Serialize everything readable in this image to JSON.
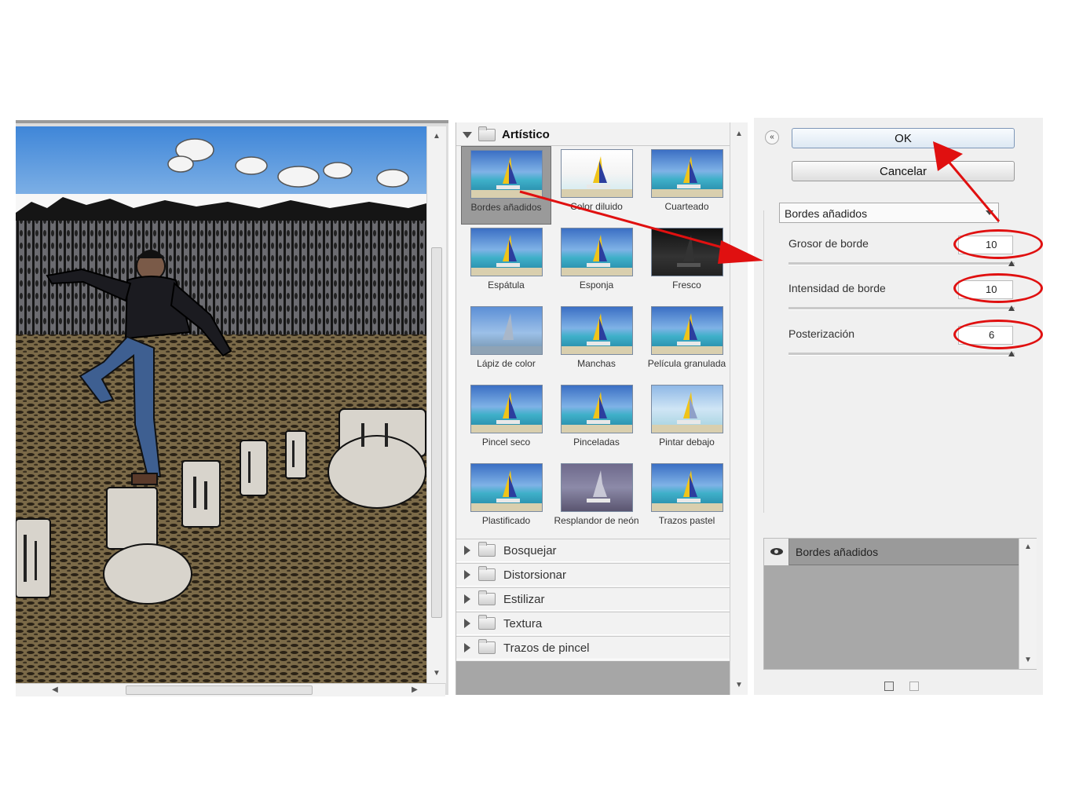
{
  "gallery": {
    "open_category": "Artístico",
    "thumbnails": [
      {
        "label": "Bordes añadidos",
        "selected": true
      },
      {
        "label": "Color diluido"
      },
      {
        "label": "Cuarteado"
      },
      {
        "label": "Espátula"
      },
      {
        "label": "Esponja"
      },
      {
        "label": "Fresco"
      },
      {
        "label": "Lápiz de color"
      },
      {
        "label": "Manchas"
      },
      {
        "label": "Película granulada"
      },
      {
        "label": "Pincel seco"
      },
      {
        "label": "Pinceladas"
      },
      {
        "label": "Pintar debajo"
      },
      {
        "label": "Plastificado"
      },
      {
        "label": "Resplandor de neón"
      },
      {
        "label": "Trazos pastel"
      }
    ],
    "collapsed_categories": [
      "Bosquejar",
      "Distorsionar",
      "Estilizar",
      "Textura",
      "Trazos de pincel"
    ]
  },
  "settings": {
    "ok_label": "OK",
    "cancel_label": "Cancelar",
    "filter_select": "Bordes añadidos",
    "params": [
      {
        "label": "Grosor de borde",
        "value": "10"
      },
      {
        "label": "Intensidad de borde",
        "value": "10"
      },
      {
        "label": "Posterización",
        "value": "6"
      }
    ]
  },
  "layers": {
    "items": [
      {
        "label": "Bordes añadidos",
        "visible": true
      }
    ]
  },
  "colors": {
    "annotation": "#e01010",
    "panel_bg": "#f0f0f0",
    "selected_thumb": "#9a9a9a"
  }
}
